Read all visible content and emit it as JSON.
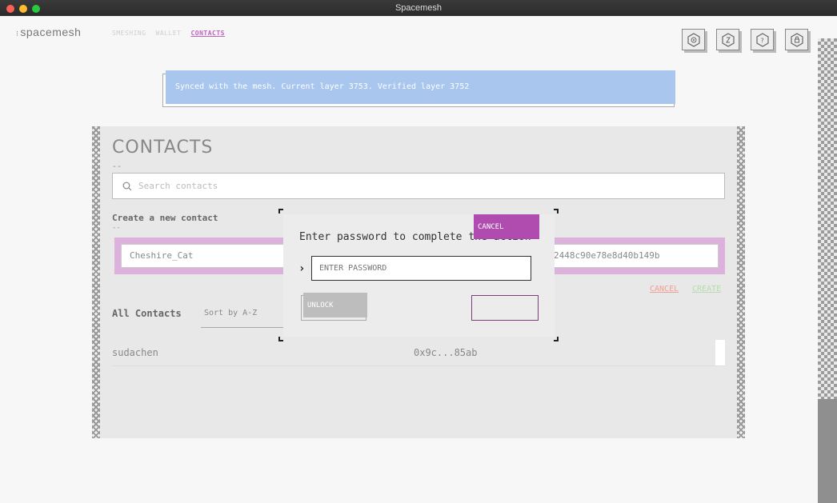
{
  "window": {
    "title": "Spacemesh"
  },
  "header": {
    "logo": "spacemesh",
    "nav": [
      {
        "label": "SMESHING",
        "active": false
      },
      {
        "label": "WALLET",
        "active": false
      },
      {
        "label": "CONTACTS",
        "active": true
      }
    ],
    "icons": [
      "network-icon",
      "wallet-icon",
      "help-icon",
      "lock-icon"
    ]
  },
  "banner": {
    "text": "Synced with the mesh. Current layer 3753. Verified layer 3752"
  },
  "contacts": {
    "title": "CONTACTS",
    "title_underline": "--",
    "search": {
      "placeholder": "Search contacts"
    },
    "create": {
      "label": "Create a new contact",
      "underline": "--",
      "name_value": "Cheshire_Cat",
      "address_value": "2448c90e78e8d40b149b",
      "cancel_label": "CANCEL",
      "create_label": "CREATE"
    },
    "list": {
      "label": "All Contacts",
      "sort": "Sort by A-Z",
      "items": [
        {
          "name": "sudachen",
          "address": "0x9c...85ab"
        }
      ]
    }
  },
  "modal": {
    "title": "Enter password to complete the action",
    "password_placeholder": "ENTER PASSWORD",
    "unlock_label": "UNLOCK",
    "cancel_label": "CANCEL"
  },
  "colors": {
    "accent": "#b04cb0",
    "banner": "#a8c6ee",
    "create_row": "#dcb2dc"
  }
}
